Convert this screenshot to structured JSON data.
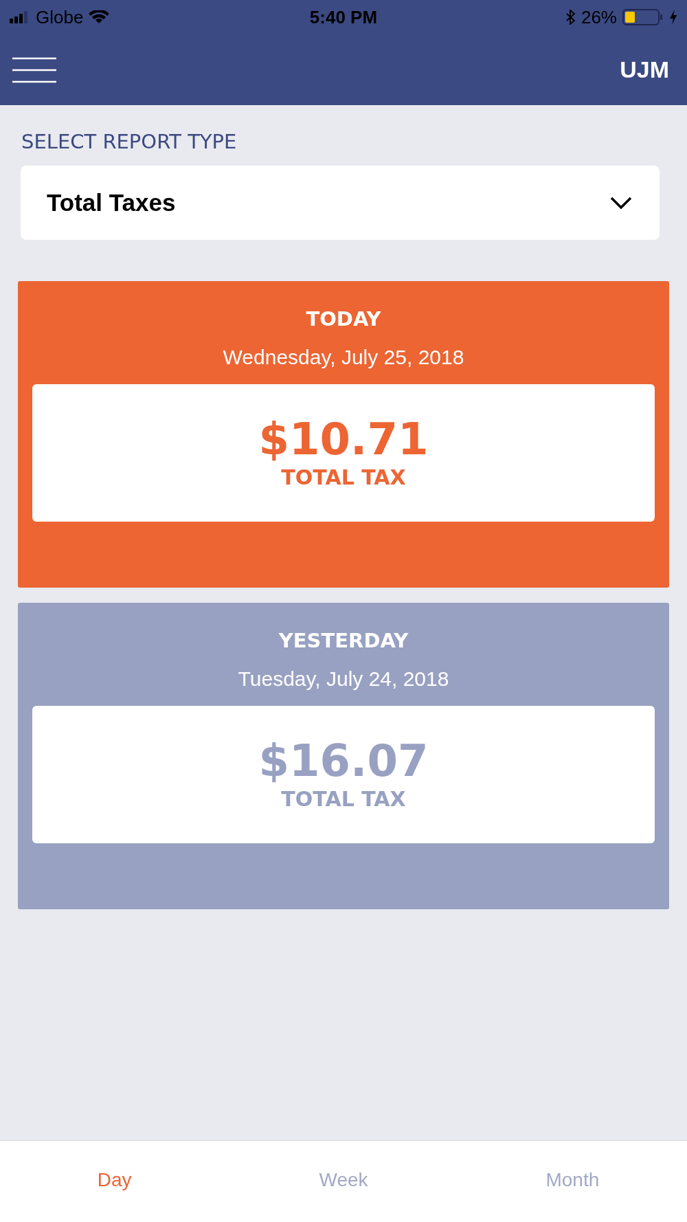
{
  "status_bar": {
    "carrier": "Globe",
    "time": "5:40 PM",
    "battery": "26%"
  },
  "header": {
    "initials": "UJM"
  },
  "report_type": {
    "label": "SELECT REPORT TYPE",
    "value": "Total Taxes"
  },
  "cards": [
    {
      "title": "TODAY",
      "date": "Wednesday, July 25, 2018",
      "amount": "$10.71",
      "caption": "TOTAL TAX",
      "color": "#ec6533"
    },
    {
      "title": "YESTERDAY",
      "date": "Tuesday, July 24, 2018",
      "amount": "$16.07",
      "caption": "TOTAL TAX",
      "color": "#98a1c1"
    }
  ],
  "tabs": [
    {
      "label": "Day",
      "selected": true
    },
    {
      "label": "Week",
      "selected": false
    },
    {
      "label": "Month",
      "selected": false
    }
  ]
}
